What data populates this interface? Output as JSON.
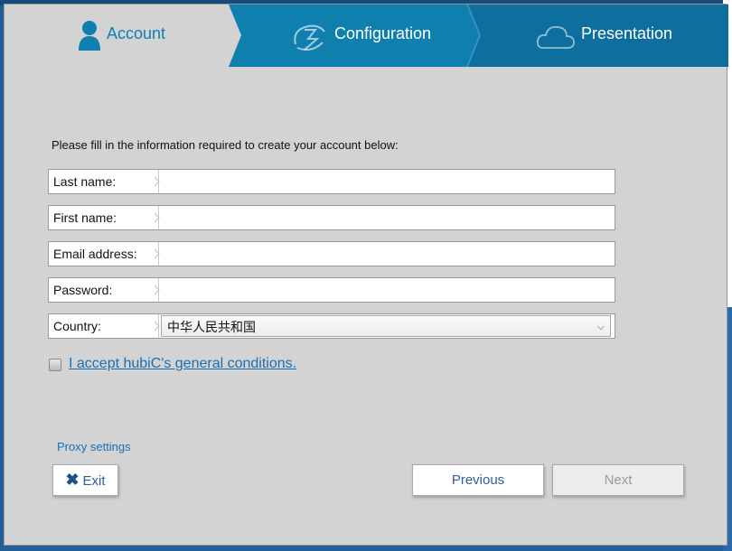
{
  "tabs": [
    {
      "label": "Account",
      "icon": "user-icon",
      "active": true
    },
    {
      "label": "Configuration",
      "icon": "configuration-icon",
      "active": false
    },
    {
      "label": "Presentation",
      "icon": "cloud-icon",
      "active": false
    }
  ],
  "form": {
    "intro": "Please fill in the information required to create your account below:",
    "fields": [
      {
        "label": "Last name:",
        "value": ""
      },
      {
        "label": "First name:",
        "value": ""
      },
      {
        "label": "Email address:",
        "value": ""
      },
      {
        "label": "Password:",
        "value": ""
      }
    ],
    "country": {
      "label": "Country:",
      "selected": "中华人民共和国"
    },
    "accept_label": "I accept hubiC's general conditions.",
    "accept_checked": false
  },
  "proxy_label": "Proxy settings",
  "buttons": {
    "exit": "Exit",
    "previous": "Previous",
    "next": "Next"
  },
  "colors": {
    "tab_blue": "#0f7fae",
    "tab_dark": "#0e5f8e",
    "link": "#1670b8"
  }
}
